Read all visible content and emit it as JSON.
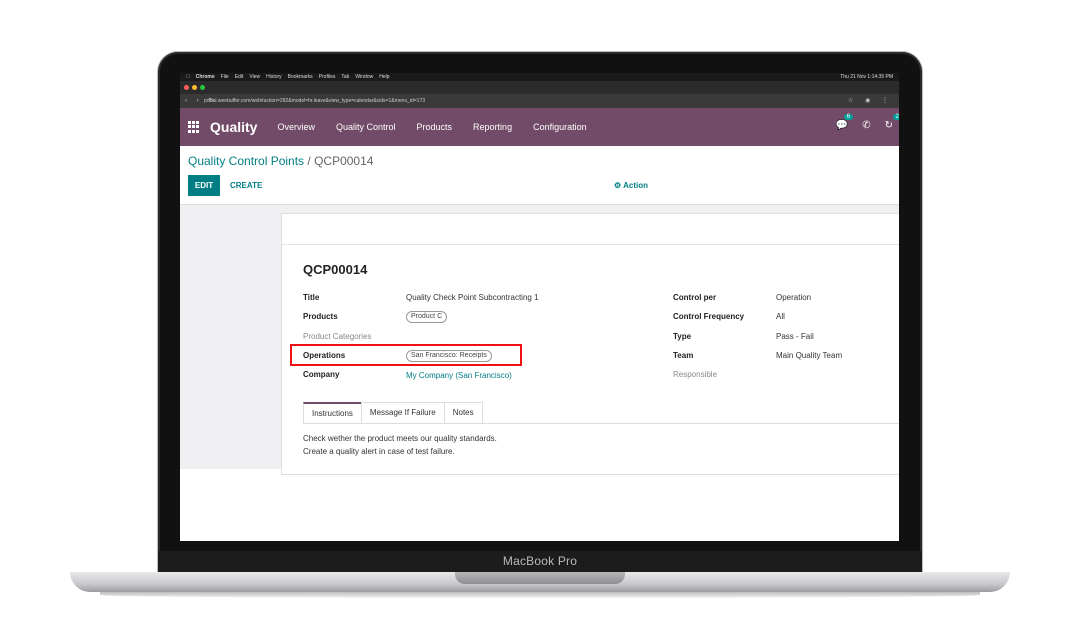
{
  "laptop": {
    "label": "MacBook Pro"
  },
  "os_menubar": {
    "app": "Chrome",
    "items": [
      "File",
      "Edit",
      "View",
      "History",
      "Bookmarks",
      "Profiles",
      "Tab",
      "Window",
      "Help"
    ],
    "clock": "Thu 21 Nov 1:14:35 PM"
  },
  "browser": {
    "url": "portal.weebuffer.com/web#action=282&model=hr.leave&view_type=calendar&cids=1&menu_id=173"
  },
  "topnav": {
    "app_title": "Quality",
    "menu": [
      "Overview",
      "Quality Control",
      "Products",
      "Reporting",
      "Configuration"
    ],
    "chat_badge": "6",
    "activity_badge": "26"
  },
  "control": {
    "breadcrumb_parent": "Quality Control Points",
    "breadcrumb_sep": " / ",
    "breadcrumb_current": "QCP00014",
    "edit_label": "EDIT",
    "create_label": "CREATE",
    "action_label": "Action"
  },
  "record": {
    "title": "QCP00014",
    "left": {
      "title_label": "Title",
      "title_value": "Quality Check Point Subcontracting 1",
      "products_label": "Products",
      "products_value": "Product C",
      "categories_label": "Product Categories",
      "operations_label": "Operations",
      "operations_value": "San Francisco: Receipts",
      "company_label": "Company",
      "company_value": "My Company (San Francisco)"
    },
    "right": {
      "control_per_label": "Control per",
      "control_per_value": "Operation",
      "frequency_label": "Control Frequency",
      "frequency_value": "All",
      "type_label": "Type",
      "type_value": "Pass - Fail",
      "team_label": "Team",
      "team_value": "Main Quality Team",
      "responsible_label": "Responsible"
    },
    "tabs": [
      "Instructions",
      "Message If Failure",
      "Notes"
    ],
    "instructions": [
      "Check wether the product meets our quality standards.",
      "Create a quality alert in case of test failure."
    ]
  },
  "colors": {
    "brand": "#714b67",
    "accent": "#017e84",
    "highlight": "#e11111"
  }
}
